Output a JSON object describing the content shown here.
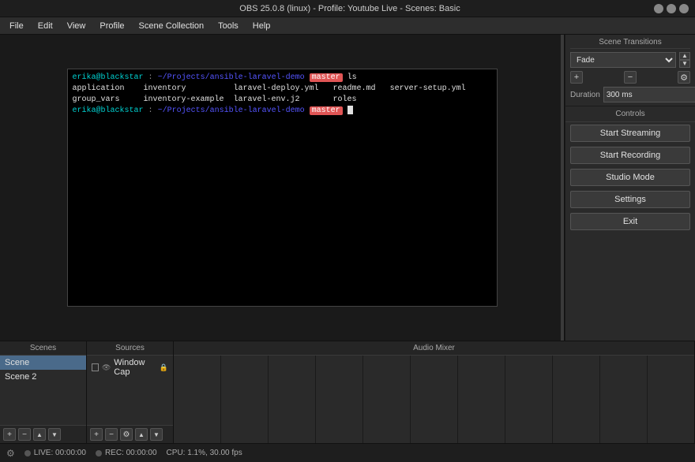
{
  "titleBar": {
    "title": "OBS 25.0.8 (linux) - Profile: Youtube Live - Scenes: Basic"
  },
  "menuBar": {
    "items": [
      "File",
      "Edit",
      "View",
      "Profile",
      "Scene Collection",
      "Tools",
      "Help"
    ]
  },
  "terminal": {
    "lines": [
      {
        "prompt": "erika@blackstar",
        "path": "~/Projects/ansible-laravel-demo",
        "branch": "master",
        "cmd": "ls"
      },
      {
        "indent": "application    inventory          laravel-deploy.yml    readme.md    server-setup.yml"
      },
      {
        "indent": "group_vars     inventory-example  laravel-env.j2        roles"
      },
      {
        "prompt": "erika@blackstar",
        "path": "~/Projects/ansible-laravel-demo",
        "branch": "master",
        "cmd": ""
      }
    ]
  },
  "sceneTransitions": {
    "title": "Scene Transitions",
    "fade": "Fade",
    "durationLabel": "Duration",
    "durationValue": "300 ms"
  },
  "controls": {
    "title": "Controls",
    "buttons": [
      "Start Streaming",
      "Start Recording",
      "Studio Mode",
      "Settings",
      "Exit"
    ]
  },
  "scenes": {
    "title": "Scenes",
    "items": [
      "Scene",
      "Scene 2"
    ],
    "activeIndex": 0
  },
  "sources": {
    "title": "Sources",
    "items": [
      {
        "name": "Window Cap",
        "visible": true
      }
    ]
  },
  "audioMixer": {
    "title": "Audio Mixer"
  },
  "statusBar": {
    "live": "LIVE: 00:00:00",
    "rec": "REC: 00:00:00",
    "cpu": "CPU: 1.1%, 30.00 fps"
  }
}
